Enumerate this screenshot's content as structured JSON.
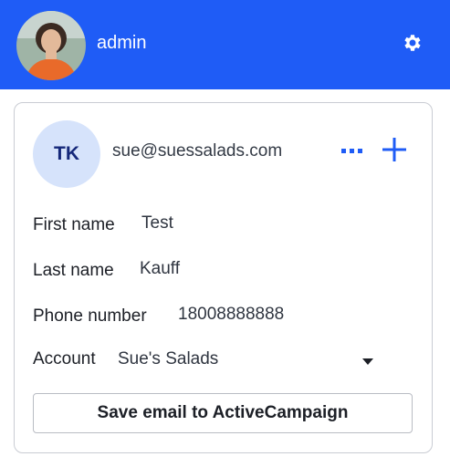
{
  "header": {
    "username": "admin",
    "background_color": "#1f5cf6",
    "avatar_icon": "user-photo",
    "settings_icon": "gear-icon"
  },
  "contact": {
    "initials": "TK",
    "email": "sue@suessalads.com",
    "more_icon": "more-horizontal-icon",
    "add_icon": "plus-icon",
    "fields": {
      "first_name": {
        "label": "First name",
        "value": "Test"
      },
      "last_name": {
        "label": "Last name",
        "value": "Kauff"
      },
      "phone": {
        "label": "Phone number",
        "value": "18008888888"
      },
      "account": {
        "label": "Account",
        "value": "Sue's Salads"
      }
    },
    "save_button_label": "Save email to ActiveCampaign"
  },
  "colors": {
    "accent": "#1f5cf6",
    "initials_bg": "#d6e3fb",
    "initials_text": "#15287a"
  }
}
